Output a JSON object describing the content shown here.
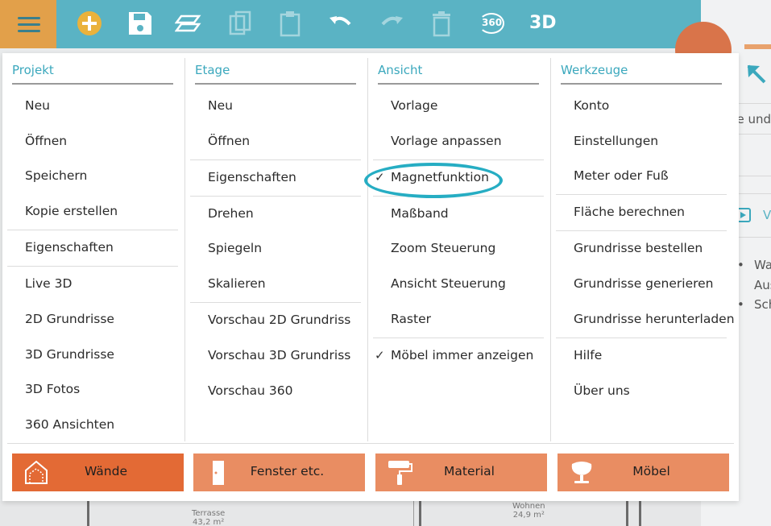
{
  "toolbar": {
    "icons": [
      "menu-icon",
      "add-icon",
      "save-icon",
      "floor-icon",
      "copy-icon",
      "paste-icon",
      "undo-icon",
      "redo-icon",
      "delete-icon",
      "view-360-icon",
      "view-3d-icon"
    ],
    "label_360": "360",
    "label_3d": "3D"
  },
  "right_panel": {
    "hint": "de und",
    "v_label": "V",
    "bullets": [
      {
        "bullet": "•",
        "text": "Wa"
      },
      {
        "text": "Aus"
      },
      {
        "bullet": "•",
        "text": "Sch"
      }
    ]
  },
  "floor_plan": {
    "rooms": [
      {
        "name": "Terrasse",
        "area": "43,2 m²"
      },
      {
        "name": "Wohnen",
        "area": "24,9 m²"
      }
    ]
  },
  "menu": {
    "columns": [
      {
        "title": "Projekt",
        "items": [
          "Neu",
          "Öffnen",
          "Speichern",
          "Kopie erstellen",
          "Eigenschaften",
          "Live 3D",
          "2D Grundrisse",
          "3D Grundrisse",
          "3D Fotos",
          "360 Ansichten"
        ]
      },
      {
        "title": "Etage",
        "items": [
          "Neu",
          "Öffnen",
          "Eigenschaften",
          "Drehen",
          "Spiegeln",
          "Skalieren",
          "Vorschau 2D Grundriss",
          "Vorschau 3D Grundriss",
          "Vorschau 360"
        ]
      },
      {
        "title": "Ansicht",
        "items": [
          "Vorlage",
          "Vorlage anpassen",
          "Magnetfunktion",
          "Maßband",
          "Zoom Steuerung",
          "Ansicht Steuerung",
          "Raster",
          "Möbel immer anzeigen"
        ],
        "checkmark": "✓"
      },
      {
        "title": "Werkzeuge",
        "items": [
          "Konto",
          "Einstellungen",
          "Meter oder Fuß",
          "Fläche berechnen",
          "Grundrisse bestellen",
          "Grundrisse generieren",
          "Grundrisse herunterladen",
          "Hilfe",
          "Über uns"
        ]
      }
    ],
    "checked_items": [
      "Magnetfunktion",
      "Möbel immer anzeigen"
    ],
    "highlighted_item": "Magnetfunktion",
    "categories": [
      {
        "label": "Wände",
        "icon": "walls-icon",
        "active": true
      },
      {
        "label": "Fenster etc.",
        "icon": "door-icon",
        "active": false
      },
      {
        "label": "Material",
        "icon": "paint-roller-icon",
        "active": false
      },
      {
        "label": "Möbel",
        "icon": "chair-icon",
        "active": false
      }
    ]
  },
  "colors": {
    "toolbar": "#5ab3c4",
    "menu_button": "#e2a04a",
    "accent_teal": "#3ba8bd",
    "category_active": "#e36a35",
    "category": "#e98d62"
  }
}
